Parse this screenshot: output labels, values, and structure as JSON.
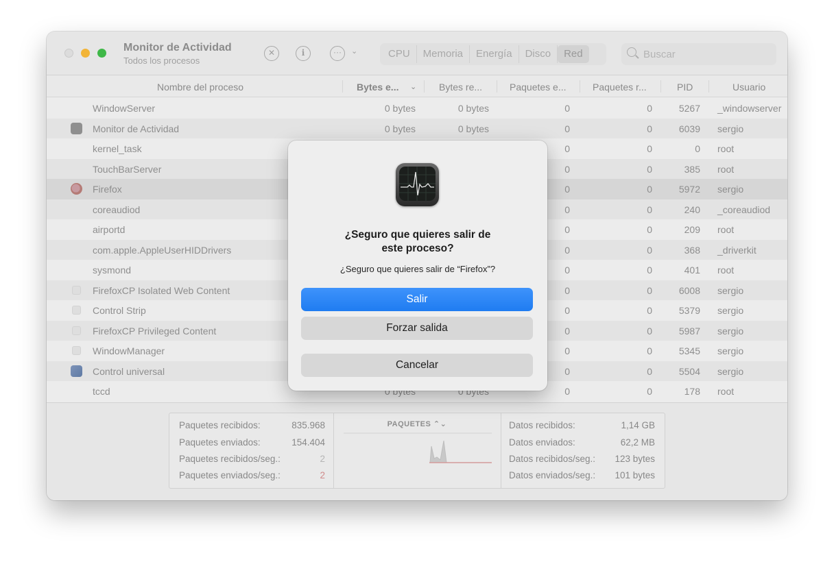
{
  "window": {
    "title": "Monitor de Actividad",
    "subtitle": "Todos los procesos"
  },
  "toolbar": {
    "stop_icon": "x-circle-icon",
    "info_icon": "info-icon",
    "more_icon": "ellipsis-icon",
    "tabs": [
      "CPU",
      "Memoria",
      "Energía",
      "Disco",
      "Red"
    ],
    "active_tab": "Red",
    "search_placeholder": "Buscar"
  },
  "table": {
    "columns": [
      "Nombre del proceso",
      "Bytes e...",
      "Bytes re...",
      "Paquetes e...",
      "Paquetes r...",
      "PID",
      "Usuario"
    ],
    "rows": [
      {
        "name": "WindowServer",
        "icon": "none",
        "sent": "0 bytes",
        "recv": "0 bytes",
        "psent": "0",
        "precv": "0",
        "pid": "5267",
        "user": "_windowserver"
      },
      {
        "name": "Monitor de Actividad",
        "icon": "activity-monitor-icon",
        "sent": "0 bytes",
        "recv": "0 bytes",
        "psent": "0",
        "precv": "0",
        "pid": "6039",
        "user": "sergio"
      },
      {
        "name": "kernel_task",
        "icon": "none",
        "sent": "",
        "recv": "",
        "psent": "0",
        "precv": "0",
        "pid": "0",
        "user": "root"
      },
      {
        "name": "TouchBarServer",
        "icon": "none",
        "sent": "",
        "recv": "",
        "psent": "0",
        "precv": "0",
        "pid": "385",
        "user": "root"
      },
      {
        "name": "Firefox",
        "icon": "firefox-icon",
        "sent": "",
        "recv": "",
        "psent": "0",
        "precv": "0",
        "pid": "5972",
        "user": "sergio"
      },
      {
        "name": "coreaudiod",
        "icon": "none",
        "sent": "",
        "recv": "",
        "psent": "0",
        "precv": "0",
        "pid": "240",
        "user": "_coreaudiod"
      },
      {
        "name": "airportd",
        "icon": "none",
        "sent": "",
        "recv": "",
        "psent": "0",
        "precv": "0",
        "pid": "209",
        "user": "root"
      },
      {
        "name": "com.apple.AppleUserHIDDrivers",
        "icon": "none",
        "sent": "",
        "recv": "",
        "psent": "0",
        "precv": "0",
        "pid": "368",
        "user": "_driverkit"
      },
      {
        "name": "sysmond",
        "icon": "none",
        "sent": "",
        "recv": "",
        "psent": "0",
        "precv": "0",
        "pid": "401",
        "user": "root"
      },
      {
        "name": "FirefoxCP Isolated Web Content",
        "icon": "blank-icon",
        "sent": "",
        "recv": "",
        "psent": "0",
        "precv": "0",
        "pid": "6008",
        "user": "sergio"
      },
      {
        "name": "Control Strip",
        "icon": "blank-icon",
        "sent": "",
        "recv": "",
        "psent": "0",
        "precv": "0",
        "pid": "5379",
        "user": "sergio"
      },
      {
        "name": "FirefoxCP Privileged Content",
        "icon": "blank-icon",
        "sent": "",
        "recv": "",
        "psent": "0",
        "precv": "0",
        "pid": "5987",
        "user": "sergio"
      },
      {
        "name": "WindowManager",
        "icon": "blank-icon",
        "sent": "",
        "recv": "",
        "psent": "0",
        "precv": "0",
        "pid": "5345",
        "user": "sergio"
      },
      {
        "name": "Control universal",
        "icon": "universal-control-icon",
        "sent": "",
        "recv": "",
        "psent": "0",
        "precv": "0",
        "pid": "5504",
        "user": "sergio"
      },
      {
        "name": "tccd",
        "icon": "none",
        "sent": "0 bytes",
        "recv": "0 bytes",
        "psent": "0",
        "precv": "0",
        "pid": "178",
        "user": "root"
      }
    ]
  },
  "stats": {
    "left": [
      {
        "label": "Paquetes recibidos:",
        "value": "835.968"
      },
      {
        "label": "Paquetes enviados:",
        "value": "154.404"
      },
      {
        "label": "Paquetes recibidos/seg.:",
        "value": "2"
      },
      {
        "label": "Paquetes enviados/seg.:",
        "value": "2"
      }
    ],
    "graph_title": "PAQUETES",
    "right": [
      {
        "label": "Datos recibidos:",
        "value": "1,14 GB"
      },
      {
        "label": "Datos enviados:",
        "value": "62,2 MB"
      },
      {
        "label": "Datos recibidos/seg.:",
        "value": "123 bytes"
      },
      {
        "label": "Datos enviados/seg.:",
        "value": "101 bytes"
      }
    ]
  },
  "dialog": {
    "title_line1": "¿Seguro que quieres salir de",
    "title_line2": "este proceso?",
    "message": "¿Seguro que quieres salir de “Firefox”?",
    "quit_label": "Salir",
    "force_quit_label": "Forzar salida",
    "cancel_label": "Cancelar"
  },
  "colors": {
    "primary_button": "#1f7cf1",
    "traffic_min": "#f2b437",
    "traffic_max": "#3fb848",
    "sent_accent": "#d08a8a"
  }
}
